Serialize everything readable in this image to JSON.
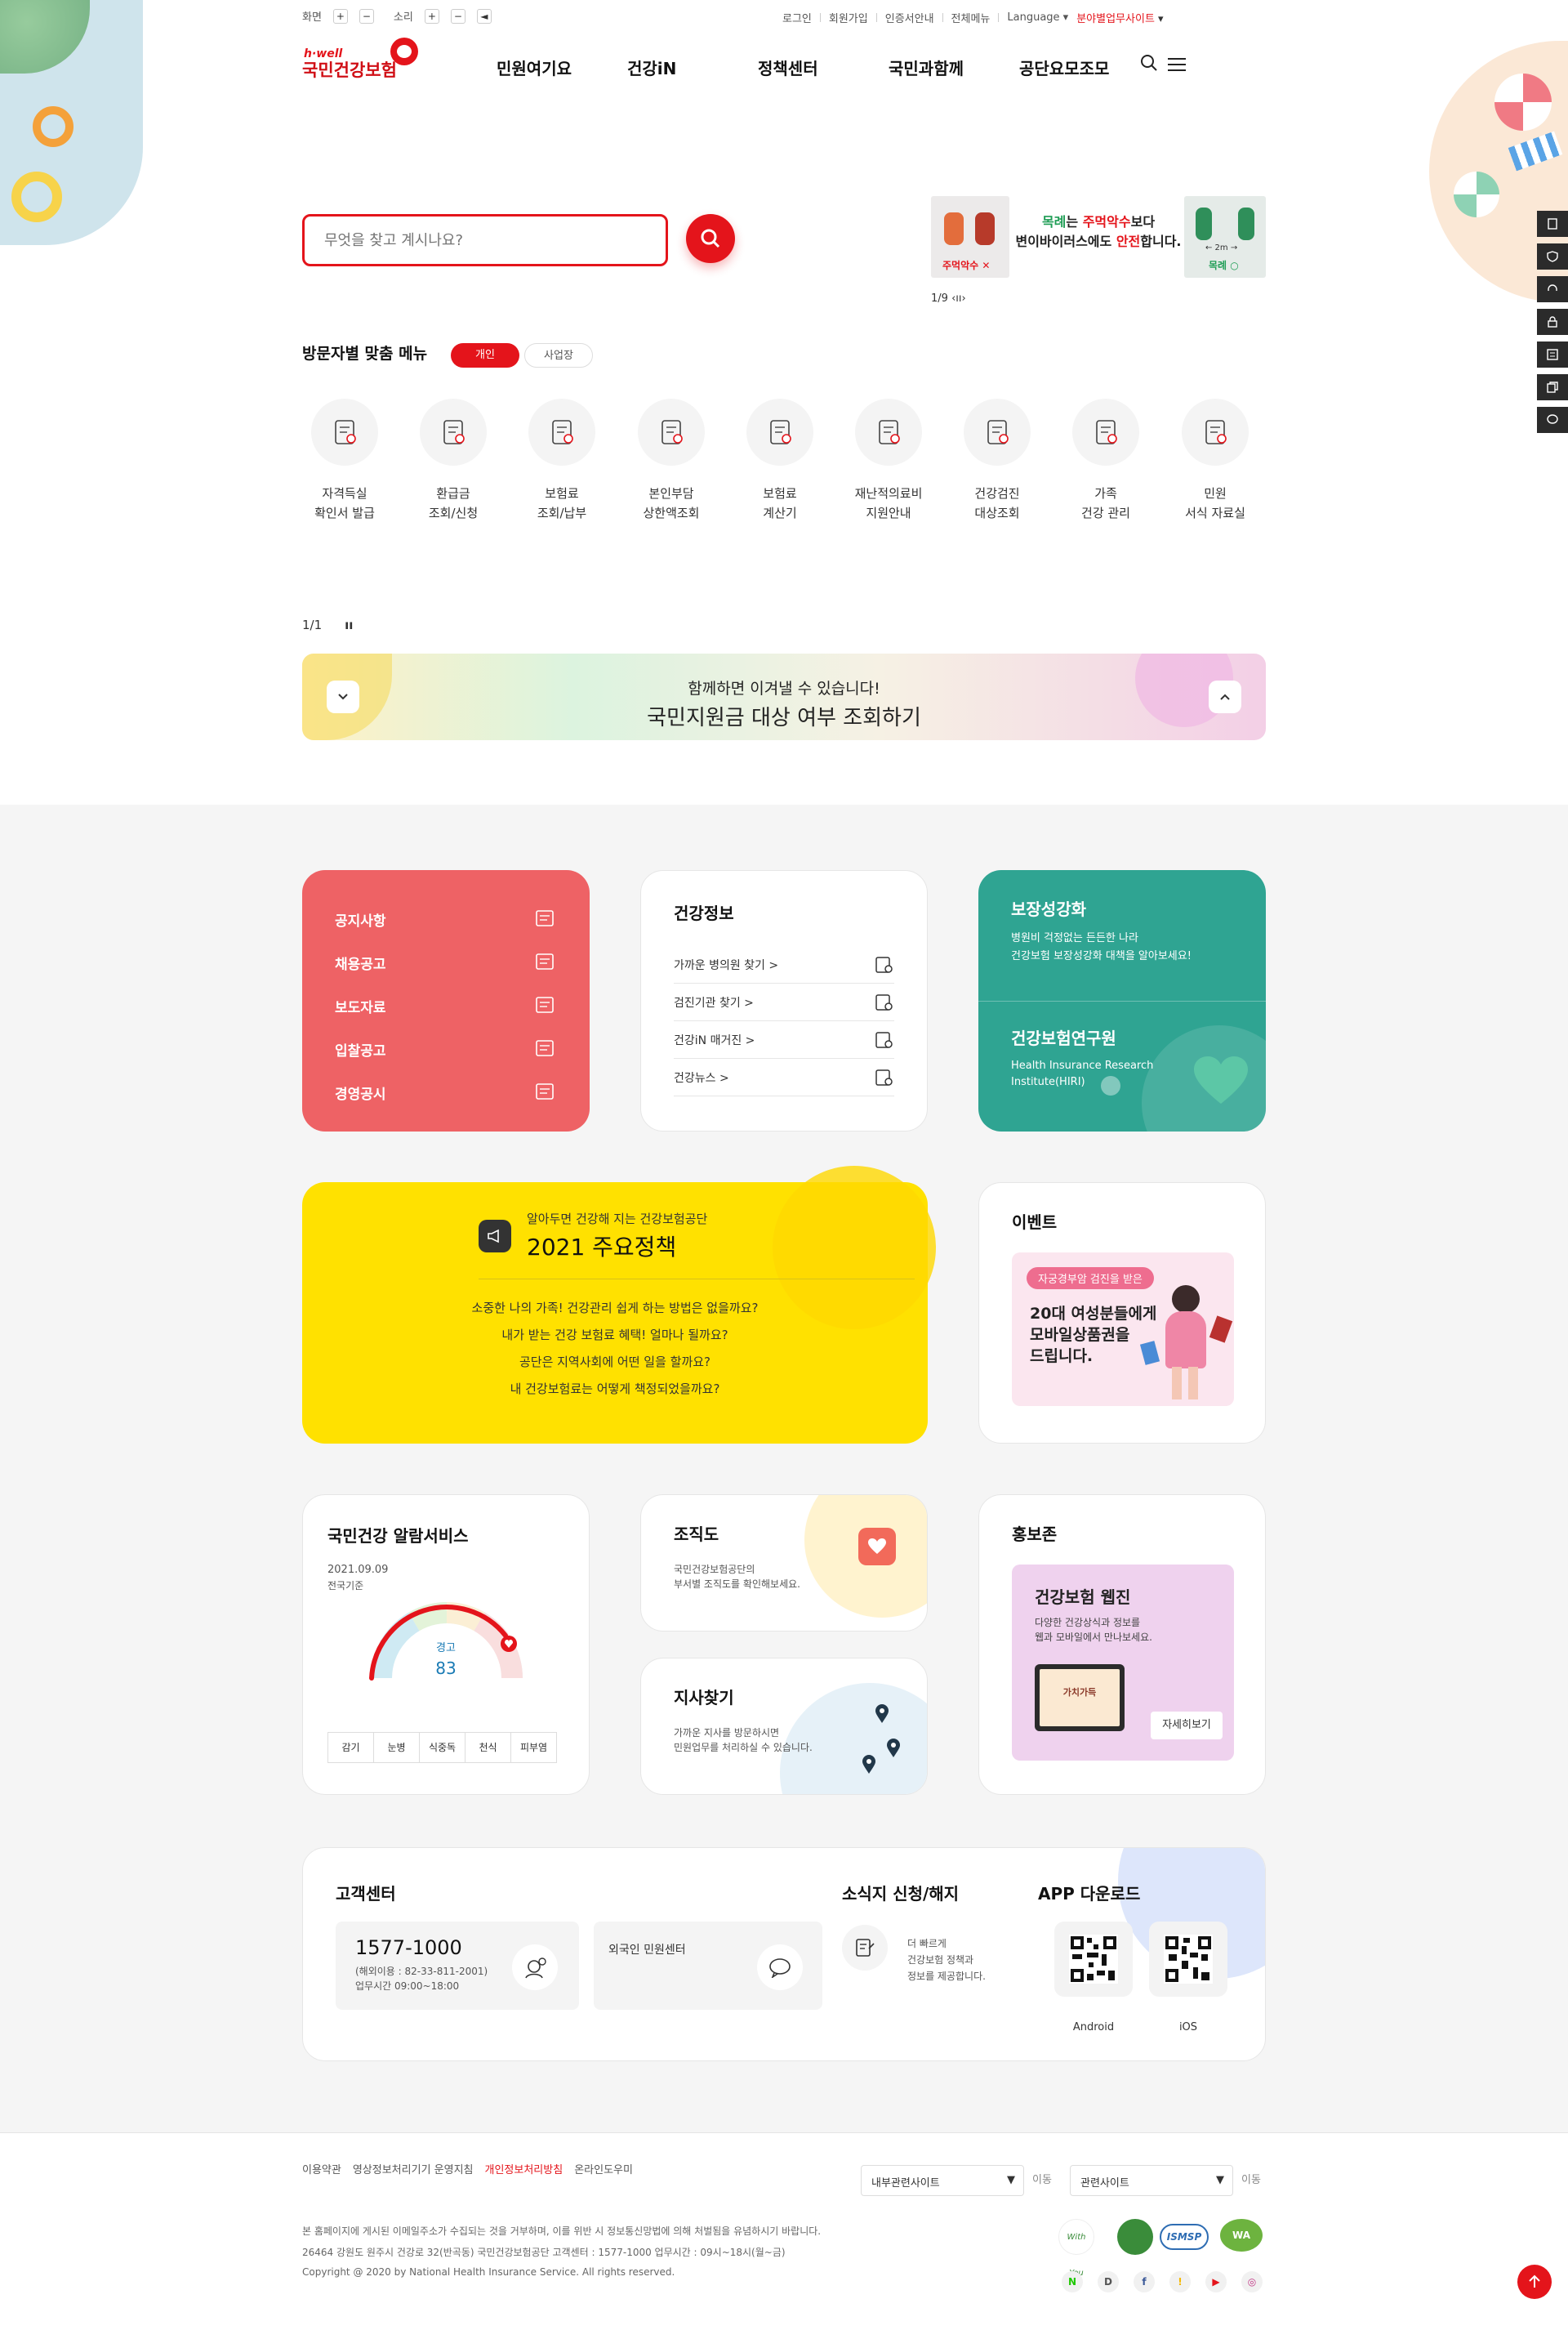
{
  "util": {
    "screen_label": "화면",
    "sound_label": "소리",
    "plus": "+",
    "minus": "−"
  },
  "toplinks": [
    "로그인",
    "회원가입",
    "인증서안내",
    "전체메뉴",
    "Language",
    "분야별업무사이트"
  ],
  "brand": {
    "sub": "h·well",
    "name": "국민건강보험"
  },
  "nav": [
    "민원여기요",
    "건강iN",
    "정책센터",
    "국민과함께",
    "공단요모조모"
  ],
  "search": {
    "placeholder": "무엇을 찾고 계시나요?"
  },
  "ad": {
    "line1a": "목례",
    "line1b": "는 ",
    "line1c": "주먹악수",
    "line1d": "보다",
    "line2a": "변이바이러스에도 ",
    "line2b": "안전",
    "line2c": "합니다.",
    "left_tag": "주먹악수 ✕",
    "right_tag": "목례 ○",
    "right_dist": "← 2m →",
    "pager": "1/9"
  },
  "visitor": {
    "title": "방문자별 맞춤 메뉴",
    "tab_active": "개인",
    "tab_inactive": "사업장",
    "items": [
      {
        "l1": "자격득실",
        "l2": "확인서 발급",
        "icon": "certificate-icon"
      },
      {
        "l1": "환급금",
        "l2": "조회/신청",
        "icon": "refund-monitor-icon"
      },
      {
        "l1": "보험료",
        "l2": "조회/납부",
        "icon": "bill-payment-icon"
      },
      {
        "l1": "본인부담",
        "l2": "상한액조회",
        "icon": "document-search-icon"
      },
      {
        "l1": "보험료",
        "l2": "계산기",
        "icon": "calculator-icon"
      },
      {
        "l1": "재난적의료비",
        "l2": "지원안내",
        "icon": "disaster-medical-icon"
      },
      {
        "l1": "건강검진",
        "l2": "대상조회",
        "icon": "checkup-person-icon"
      },
      {
        "l1": "가족",
        "l2": "건강 관리",
        "icon": "family-heart-icon"
      },
      {
        "l1": "민원",
        "l2": "서식 자료실",
        "icon": "forms-search-icon"
      }
    ]
  },
  "strip": {
    "pager": "1/1",
    "sub": "함께하면 이겨낼 수 있습니다!",
    "title": "국민지원금 대상 여부 조회하기"
  },
  "notice": {
    "items": [
      "공지사항",
      "채용공고",
      "보도자료",
      "입찰공고",
      "경영공시"
    ]
  },
  "health_info": {
    "title": "건강정보",
    "items": [
      "가까운 병의원 찾기 >",
      "검진기관 찾기 >",
      "건강iN 매거진 >",
      "건강뉴스 >"
    ]
  },
  "teal": {
    "t1": "보장성강화",
    "d1a": "병원비 걱정없는 든든한 나라",
    "d1b": "건강보험 보장성강화 대책을 알아보세요!",
    "t2": "건강보험연구원",
    "d2a": "Health Insurance Research",
    "d2b": "Institute(HIRI)"
  },
  "policy": {
    "sub": "알아두면 건강해 지는 건강보험공단",
    "title": "2021 주요정책",
    "lines": [
      "소중한 나의 가족! 건강관리 쉽게 하는 방법은 없을까요?",
      "내가 받는 건강 보험료 혜택! 얼마나 될까요?",
      "공단은 지역사회에 어떤 일을 할까요?",
      "내 건강보험료는 어떻게 책정되었을까요?"
    ]
  },
  "event": {
    "title": "이벤트",
    "tag": "자궁경부암 검진을 받은",
    "l1": "20대 여성분들에게",
    "l2": "모바일상품권을",
    "l3": "드립니다."
  },
  "alarm": {
    "title": "국민건강 알람서비스",
    "date": "2021.09.09",
    "scope": "전국기준",
    "level": "경고",
    "value": 83,
    "tabs": [
      "감기",
      "눈병",
      "식중독",
      "천식",
      "피부염"
    ]
  },
  "org": {
    "title": "조직도",
    "d1": "국민건강보험공단의",
    "d2": "부서별 조직도를 확인해보세요."
  },
  "branch": {
    "title": "지사찾기",
    "d1": "가까운 지사를 방문하시면",
    "d2": "민원업무를 처리하실 수 있습니다."
  },
  "promo": {
    "title": "홍보존",
    "card_title": "건강보험 웹진",
    "d1": "다양한 건강상식과 정보를",
    "d2": "웹과 모바일에서 만나보세요.",
    "screen_text": "가치가득",
    "more": "자세히보기"
  },
  "cs": {
    "title": "고객센터",
    "phone": "1577-1000",
    "overseas": "(해외이용 : 82-33-811-2001)",
    "hours": "업무시간 09:00~18:00",
    "foreign": "외국인 민원센터",
    "news_title": "소식지 신청/해지",
    "news1": "더 빠르게",
    "news2": "건강보험 정책과",
    "news3": "정보를 제공합니다.",
    "app_title": "APP 다운로드",
    "android": "Android",
    "ios": "iOS"
  },
  "footer": {
    "links": [
      "이용약관",
      "영상정보처리기기 운영지침",
      "개인정보처리방침",
      "온라인도우미"
    ],
    "sel1": "내부관련사이트",
    "sel2": "관련사이트",
    "go": "이동",
    "line1": "본 홈페이지에 게시된 이메일주소가 수집되는 것을 거부하며, 이를 위반 시 정보통신망법에 의해 처벌됨을 유념하시기 바랍니다.",
    "line2": "26464 강원도 원주시 건강로 32(반곡동) 국민건강보험공단 고객센터 : 1577-1000 업무시간 : 09시~18시(월~금)",
    "line3": "Copyright @ 2020 by National Health Insurance Service. All rights reserved.",
    "badges": [
      "With You",
      "",
      "ISMSP",
      "WA"
    ],
    "sns": [
      "N",
      "D",
      "f",
      "!",
      "▶",
      "◎"
    ]
  },
  "colors": {
    "brand": "#e4141b",
    "notice": "#ee6265",
    "teal": "#2fa492",
    "yellow": "#ffe100"
  }
}
